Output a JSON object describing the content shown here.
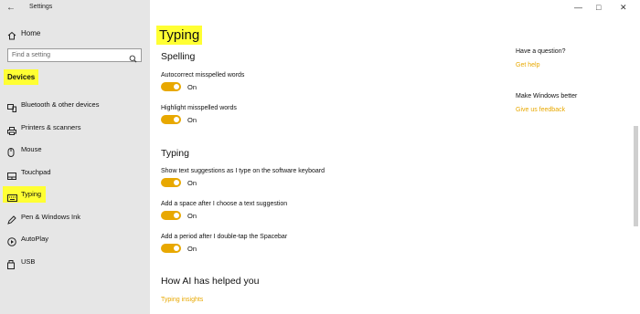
{
  "window": {
    "title": "Settings",
    "back_glyph": "←",
    "minimize": "—",
    "maximize": "□",
    "close": "✕"
  },
  "sidebar": {
    "home_label": "Home",
    "search_placeholder": "Find a setting",
    "section": "Devices",
    "items": [
      {
        "label": "Bluetooth & other devices",
        "icon": "bluetooth-devices-icon"
      },
      {
        "label": "Printers & scanners",
        "icon": "printer-icon"
      },
      {
        "label": "Mouse",
        "icon": "mouse-icon"
      },
      {
        "label": "Touchpad",
        "icon": "touchpad-icon"
      },
      {
        "label": "Typing",
        "icon": "keyboard-icon",
        "active": true
      },
      {
        "label": "Pen & Windows Ink",
        "icon": "pen-icon"
      },
      {
        "label": "AutoPlay",
        "icon": "autoplay-icon"
      },
      {
        "label": "USB",
        "icon": "usb-icon"
      }
    ]
  },
  "main": {
    "title": "Typing",
    "spelling": {
      "heading": "Spelling",
      "settings": [
        {
          "label": "Autocorrect misspelled words",
          "state": "On"
        },
        {
          "label": "Highlight misspelled words",
          "state": "On"
        }
      ]
    },
    "typing": {
      "heading": "Typing",
      "settings": [
        {
          "label": "Show text suggestions as I type on the software keyboard",
          "state": "On"
        },
        {
          "label": "Add a space after I choose a text suggestion",
          "state": "On"
        },
        {
          "label": "Add a period after I double-tap the Spacebar",
          "state": "On"
        }
      ]
    },
    "ai": {
      "heading": "How AI has helped you",
      "link": "Typing insights"
    }
  },
  "aside": {
    "question_heading": "Have a question?",
    "get_help": "Get help",
    "better_heading": "Make Windows better",
    "feedback": "Give us feedback"
  },
  "colors": {
    "accent": "#e8a800",
    "highlight": "#ffff33",
    "sidebar_bg": "#e6e6e6"
  }
}
